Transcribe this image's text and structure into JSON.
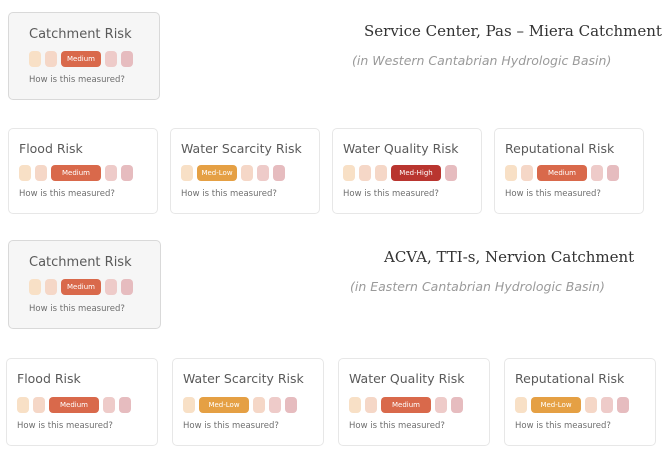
{
  "colors": {
    "light_1": "#f8e0c6",
    "light_2": "#f5d7c7",
    "pink": "#eecbc9",
    "pink_dark": "#e6bcbf",
    "medium": "#d9694b",
    "med_low": "#e5a044",
    "med_high": "#b9352f"
  },
  "help_text": "How is this measured?",
  "sections": [
    {
      "title": "Service Center, Pas – Miera Catchment",
      "subtitle": "(in Western Cantabrian Hydrologic Basin)",
      "catchment": {
        "label": "Catchment Risk",
        "level": "Medium"
      },
      "risks": [
        {
          "label": "Flood Risk",
          "level": "Medium"
        },
        {
          "label": "Water Scarcity Risk",
          "level": "Med-Low"
        },
        {
          "label": "Water Quality Risk",
          "level": "Med-High"
        },
        {
          "label": "Reputational Risk",
          "level": "Medium"
        }
      ]
    },
    {
      "title": "ACVA, TTI-s, Nervion Catchment",
      "subtitle": "(in Eastern Cantabrian Hydrologic Basin)",
      "catchment": {
        "label": "Catchment Risk",
        "level": "Medium"
      },
      "risks": [
        {
          "label": "Flood Risk",
          "level": "Medium"
        },
        {
          "label": "Water Scarcity Risk",
          "level": "Med-Low"
        },
        {
          "label": "Water Quality Risk",
          "level": "Medium"
        },
        {
          "label": "Reputational Risk",
          "level": "Med-Low"
        }
      ]
    }
  ]
}
